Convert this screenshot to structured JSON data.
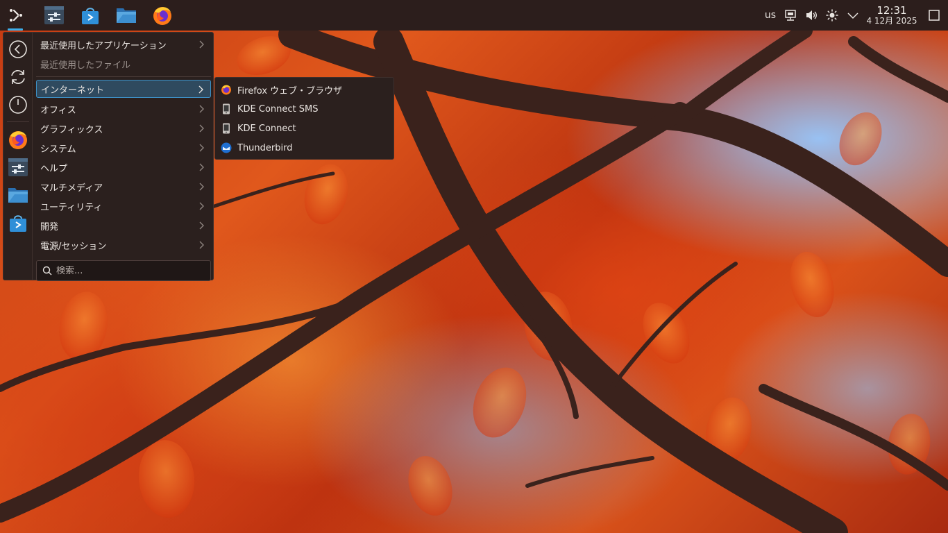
{
  "panel": {
    "launcher_icon": "kde-application-launcher-icon",
    "tasks": [
      {
        "name": "system-settings",
        "icon": "settings-sliders-icon"
      },
      {
        "name": "discover",
        "icon": "store-bag-icon"
      },
      {
        "name": "dolphin",
        "icon": "folder-icon"
      },
      {
        "name": "firefox",
        "icon": "firefox-icon"
      }
    ],
    "tray": {
      "keyboard_layout": "us",
      "icons": [
        "network-icon",
        "volume-icon",
        "brightness-icon",
        "expand-tray-icon"
      ]
    },
    "clock": {
      "time": "12:31",
      "date": "4 12月 2025"
    },
    "show_desktop_icon": "show-desktop-icon"
  },
  "menu": {
    "sidebar": {
      "actions": [
        "back-icon",
        "refresh-icon",
        "power-icon"
      ],
      "favorites": [
        "firefox-icon",
        "settings-sliders-icon",
        "folder-icon",
        "store-bag-icon"
      ]
    },
    "items": [
      {
        "label": "最近使用したアプリケーション",
        "dim": false
      },
      {
        "label": "最近使用したファイル",
        "dim": true
      },
      {
        "label": "インターネット",
        "active": true
      },
      {
        "label": "オフィス"
      },
      {
        "label": "グラフィックス"
      },
      {
        "label": "システム"
      },
      {
        "label": "ヘルプ"
      },
      {
        "label": "マルチメディア"
      },
      {
        "label": "ユーティリティ"
      },
      {
        "label": "開発"
      },
      {
        "label": "電源/セッション"
      }
    ],
    "search": {
      "placeholder": "検索..."
    }
  },
  "submenu": {
    "items": [
      {
        "label": "Firefox ウェブ・ブラウザ",
        "icon": "firefox-icon"
      },
      {
        "label": "KDE Connect SMS",
        "icon": "kde-connect-icon"
      },
      {
        "label": "KDE Connect",
        "icon": "kde-connect-icon"
      },
      {
        "label": "Thunderbird",
        "icon": "thunderbird-icon"
      }
    ]
  },
  "colors": {
    "panel_bg": "#2c1e1c",
    "menu_bg": "#2b201e",
    "accent": "#3daee9",
    "highlight": "#2f4a5f"
  }
}
